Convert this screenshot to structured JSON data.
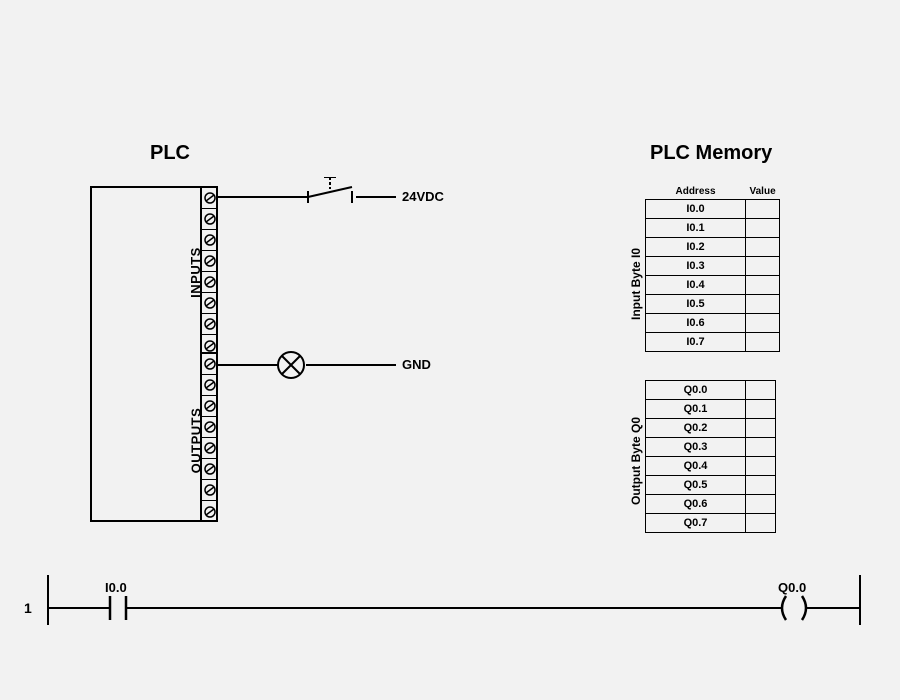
{
  "titles": {
    "plc": "PLC",
    "memory": "PLC Memory"
  },
  "plc": {
    "inputs_label": "INPUTS",
    "outputs_label": "OUTPUTS"
  },
  "wires": {
    "switch_label": "24VDC",
    "lamp_label": "GND"
  },
  "memory_headers": {
    "address": "Address",
    "value": "Value"
  },
  "memory_side": {
    "input": "Input Byte I0",
    "output": "Output Byte Q0"
  },
  "input_addresses": [
    "I0.0",
    "I0.1",
    "I0.2",
    "I0.3",
    "I0.4",
    "I0.5",
    "I0.6",
    "I0.7"
  ],
  "output_addresses": [
    "Q0.0",
    "Q0.1",
    "Q0.2",
    "Q0.3",
    "Q0.4",
    "Q0.5",
    "Q0.6",
    "Q0.7"
  ],
  "ladder": {
    "rung_number": "1",
    "contact_label": "I0.0",
    "coil_label": "Q0.0"
  }
}
